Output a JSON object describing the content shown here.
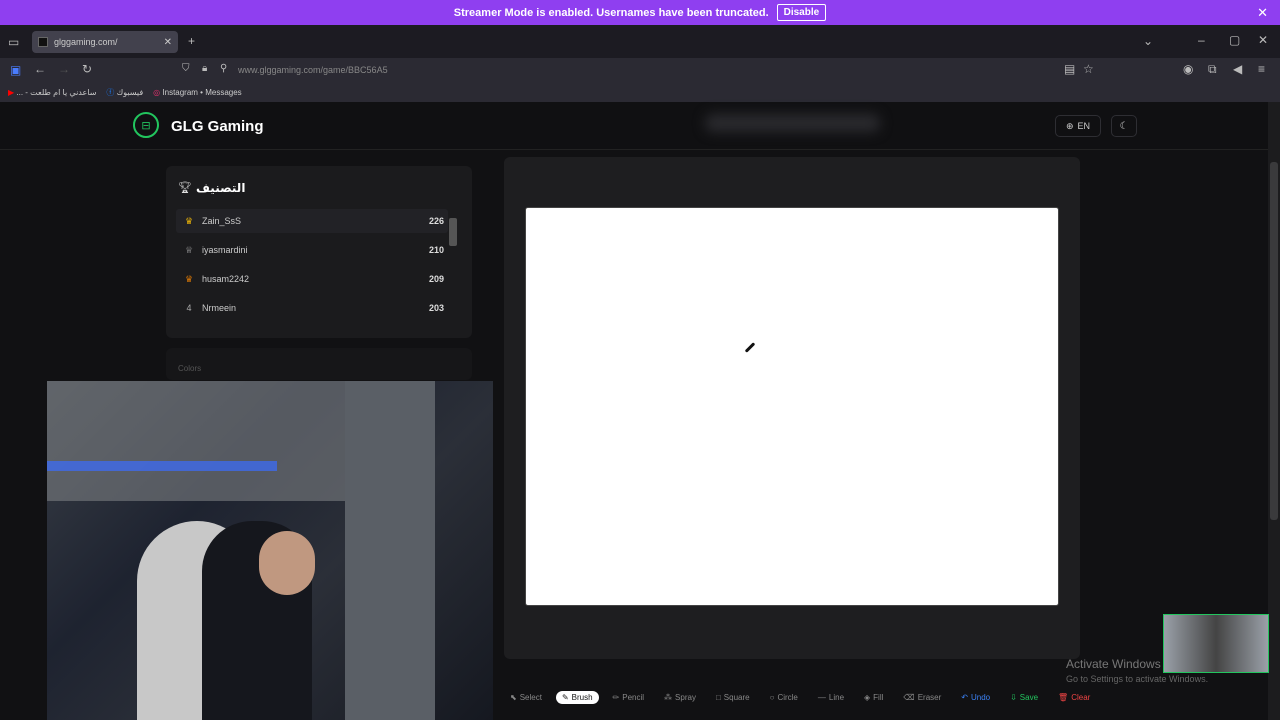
{
  "banner": {
    "message": "Streamer Mode is enabled. Usernames have been truncated.",
    "disable_label": "Disable"
  },
  "browser": {
    "tab_title": "glggaming.com/",
    "url": "www.glggaming.com/game/BBC56A5",
    "bookmarks": [
      "... - ساعدني يا ام طلعت",
      "فيسبوك",
      "Instagram • Messages"
    ]
  },
  "header": {
    "logo_text": "GLG Gaming",
    "lang": "EN"
  },
  "leaderboard": {
    "title": "التصنيف",
    "rows": [
      {
        "rank": "",
        "name": "Zain_SsS",
        "score": "226"
      },
      {
        "rank": "",
        "name": "iyasmardini",
        "score": "210"
      },
      {
        "rank": "",
        "name": "husam2242",
        "score": "209"
      },
      {
        "rank": "4",
        "name": "Nrmeein",
        "score": "203"
      }
    ]
  },
  "colors_label": "Colors",
  "tools": [
    {
      "label": "Select",
      "icon": "select-icon"
    },
    {
      "label": "Brush",
      "icon": "brush-icon"
    },
    {
      "label": "Pencil",
      "icon": "pencil-icon"
    },
    {
      "label": "Spray",
      "icon": "spray-icon"
    },
    {
      "label": "Square",
      "icon": "square-icon"
    },
    {
      "label": "Circle",
      "icon": "circle-icon"
    },
    {
      "label": "Line",
      "icon": "line-icon"
    },
    {
      "label": "Fill",
      "icon": "fill-icon"
    },
    {
      "label": "Eraser",
      "icon": "eraser-icon"
    },
    {
      "label": "Undo",
      "icon": "undo-icon"
    },
    {
      "label": "Save",
      "icon": "save-icon"
    },
    {
      "label": "Clear",
      "icon": "clear-icon"
    }
  ],
  "activate": {
    "title": "Activate Windows",
    "sub": "Go to Settings to activate Windows."
  }
}
